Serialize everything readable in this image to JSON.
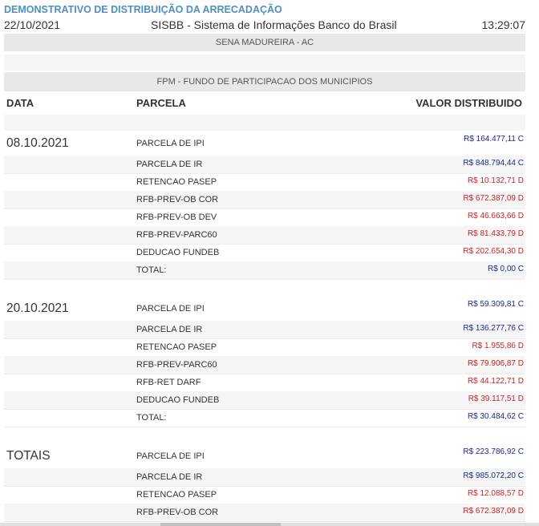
{
  "report_title": "DEMONSTRATIVO DE DISTRIBUIÇÃO DA ARRECADAÇÃO",
  "header": {
    "date": "22/10/2021",
    "system": "SISBB - Sistema de Informações Banco do Brasil",
    "time": "13:29:07"
  },
  "municipality": "SENA MADUREIRA - AC",
  "fund": "FPM - FUNDO DE PARTICIPACAO DOS MUNICIPIOS",
  "columns": {
    "date": "DATA",
    "parcel": "PARCELA",
    "value": "VALOR DISTRIBUIDO"
  },
  "colors": {
    "credit": "#1a2a8c",
    "debit": "#cc2222",
    "title": "#4f8fc0"
  },
  "groups": [
    {
      "label": "08.10.2021",
      "rows": [
        {
          "parcel": "PARCELA DE IPI",
          "value": "R$ 164.477,11 C",
          "type": "C"
        },
        {
          "parcel": "PARCELA DE IR",
          "value": "R$ 848.794,44 C",
          "type": "C"
        },
        {
          "parcel": "RETENCAO PASEP",
          "value": "R$ 10.132,71 D",
          "type": "D"
        },
        {
          "parcel": "RFB-PREV-OB COR",
          "value": "R$ 672.387,09 D",
          "type": "D"
        },
        {
          "parcel": "RFB-PREV-OB DEV",
          "value": "R$ 46.663,66 D",
          "type": "D"
        },
        {
          "parcel": "RFB-PREV-PARC60",
          "value": "R$ 81.433,79 D",
          "type": "D"
        },
        {
          "parcel": "DEDUCAO FUNDEB",
          "value": "R$ 202.654,30 D",
          "type": "D"
        },
        {
          "parcel": "TOTAL:",
          "value": "R$ 0,00 C",
          "type": "C"
        }
      ]
    },
    {
      "label": "20.10.2021",
      "rows": [
        {
          "parcel": "PARCELA DE IPI",
          "value": "R$ 59.309,81 C",
          "type": "C"
        },
        {
          "parcel": "PARCELA DE IR",
          "value": "R$ 136.277,76 C",
          "type": "C"
        },
        {
          "parcel": "RETENCAO PASEP",
          "value": "R$ 1.955,86 D",
          "type": "D"
        },
        {
          "parcel": "RFB-PREV-PARC60",
          "value": "R$ 79.906,87 D",
          "type": "D"
        },
        {
          "parcel": "RFB-RET DARF",
          "value": "R$ 44.122,71 D",
          "type": "D"
        },
        {
          "parcel": "DEDUCAO FUNDEB",
          "value": "R$ 39.117,51 D",
          "type": "D"
        },
        {
          "parcel": "TOTAL:",
          "value": "R$ 30.484,62 C",
          "type": "C"
        }
      ]
    },
    {
      "label": "TOTAIS",
      "rows": [
        {
          "parcel": "PARCELA DE IPI",
          "value": "R$ 223.786,92 C",
          "type": "C"
        },
        {
          "parcel": "PARCELA DE IR",
          "value": "R$ 985.072,20 C",
          "type": "C"
        },
        {
          "parcel": "RETENCAO PASEP",
          "value": "R$ 12.088,57 D",
          "type": "D"
        },
        {
          "parcel": "RFB-PREV-OB COR",
          "value": "R$ 672.387,09 D",
          "type": "D"
        }
      ]
    }
  ]
}
